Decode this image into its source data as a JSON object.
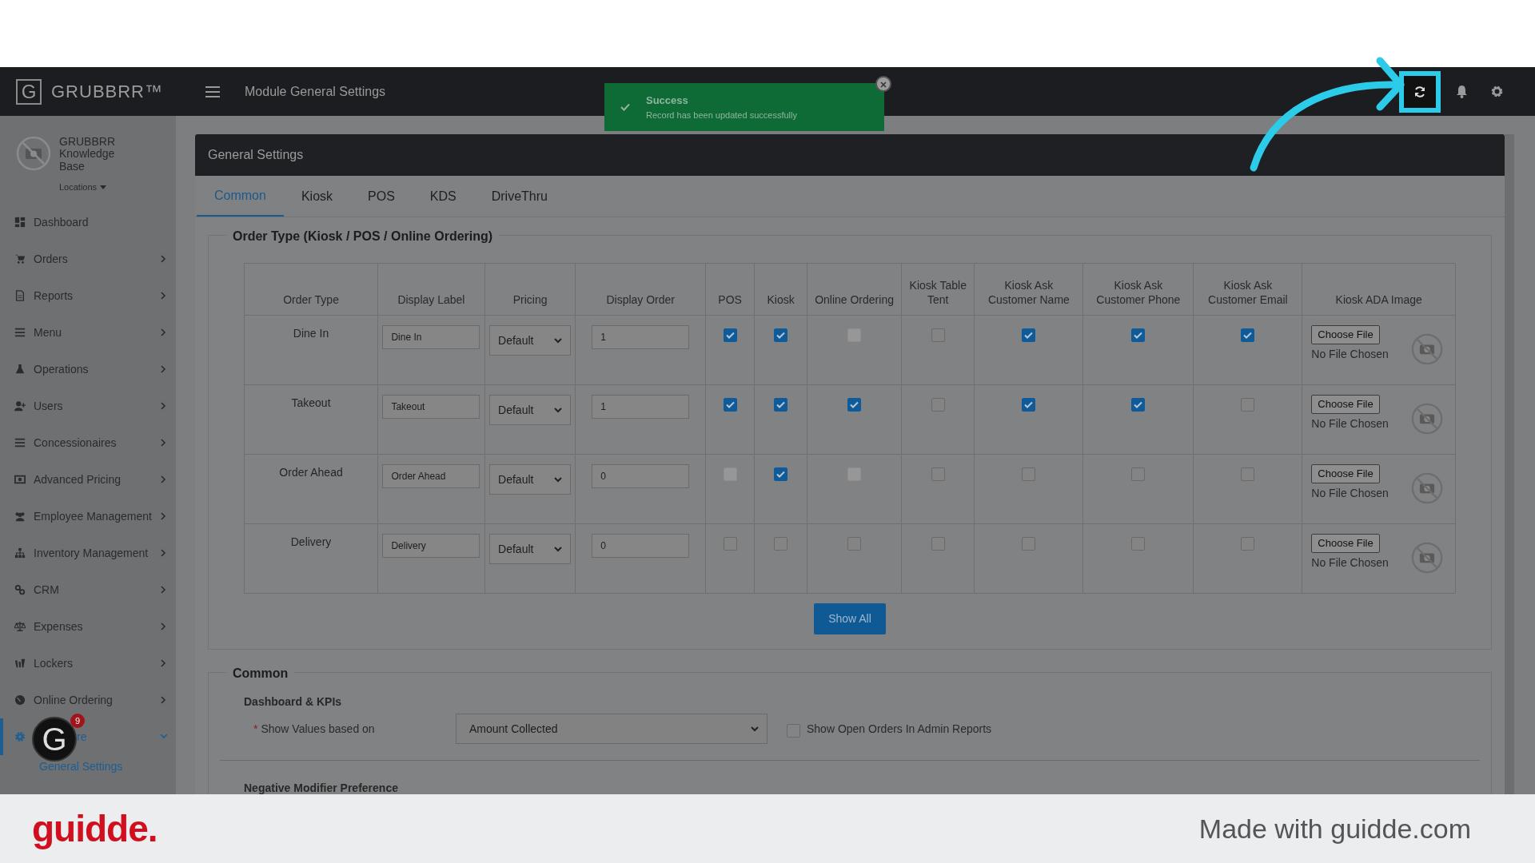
{
  "brand": {
    "logo_letter": "G",
    "name": "GRUBBRR™"
  },
  "account": {
    "name": "GRUBBRR Knowledge Base",
    "locations": "Locations"
  },
  "sidebar": {
    "items": [
      {
        "label": "Dashboard",
        "submenu": false,
        "expanded": false,
        "selected": false
      },
      {
        "label": "Orders",
        "submenu": true,
        "expanded": false,
        "selected": false
      },
      {
        "label": "Reports",
        "submenu": true,
        "expanded": false,
        "selected": false
      },
      {
        "label": "Menu",
        "submenu": true,
        "expanded": false,
        "selected": false
      },
      {
        "label": "Operations",
        "submenu": true,
        "expanded": false,
        "selected": false
      },
      {
        "label": "Users",
        "submenu": true,
        "expanded": false,
        "selected": false
      },
      {
        "label": "Concessionaires",
        "submenu": true,
        "expanded": false,
        "selected": false
      },
      {
        "label": "Advanced Pricing",
        "submenu": true,
        "expanded": false,
        "selected": false
      },
      {
        "label": "Employee Management",
        "submenu": true,
        "expanded": false,
        "selected": false
      },
      {
        "label": "Inventory Management",
        "submenu": true,
        "expanded": false,
        "selected": false
      },
      {
        "label": "CRM",
        "submenu": true,
        "expanded": false,
        "selected": false
      },
      {
        "label": "Expenses",
        "submenu": true,
        "expanded": false,
        "selected": false
      },
      {
        "label": "Lockers",
        "submenu": true,
        "expanded": false,
        "selected": false
      },
      {
        "label": "Online Ordering",
        "submenu": true,
        "expanded": false,
        "selected": false
      },
      {
        "label": "re",
        "submenu": true,
        "expanded": true,
        "selected": true,
        "children": [
          {
            "label": "General Settings",
            "selected": true
          }
        ]
      }
    ]
  },
  "guide_avatar": {
    "letter": "G",
    "badge": "9"
  },
  "topbar": {
    "title": "Module General Settings"
  },
  "toast": {
    "title": "Success",
    "message": "Record has been updated successfully"
  },
  "card": {
    "title": "General Settings"
  },
  "tabs": [
    {
      "label": "Common",
      "selected": true
    },
    {
      "label": "Kiosk",
      "selected": false
    },
    {
      "label": "POS",
      "selected": false
    },
    {
      "label": "KDS",
      "selected": false
    },
    {
      "label": "DriveThru",
      "selected": false
    }
  ],
  "order_types": {
    "legend": "Order Type (Kiosk / POS / Online Ordering)",
    "columns": [
      "Order Type",
      "Display Label",
      "Pricing",
      "Display Order",
      "POS",
      "Kiosk",
      "Online Ordering",
      "Kiosk Table Tent",
      "Kiosk Ask Customer Name",
      "Kiosk Ask Customer Phone",
      "Kiosk Ask Customer Email",
      "Kiosk ADA Image"
    ],
    "rows": [
      {
        "order_type": "Dine In",
        "label": "Dine In",
        "pricing": "Default",
        "display_order": "1",
        "file_button": "Choose File",
        "file_status": "No File Chosen",
        "flags": [
          {
            "checked": true,
            "disabled": false
          },
          {
            "checked": true,
            "disabled": false
          },
          {
            "checked": false,
            "disabled": true
          },
          {
            "checked": false,
            "disabled": false
          },
          {
            "checked": true,
            "disabled": false
          },
          {
            "checked": true,
            "disabled": false
          },
          {
            "checked": true,
            "disabled": false
          }
        ]
      },
      {
        "order_type": "Takeout",
        "label": "Takeout",
        "pricing": "Default",
        "display_order": "1",
        "file_button": "Choose File",
        "file_status": "No File Chosen",
        "flags": [
          {
            "checked": true,
            "disabled": false
          },
          {
            "checked": true,
            "disabled": false
          },
          {
            "checked": true,
            "disabled": false
          },
          {
            "checked": false,
            "disabled": false
          },
          {
            "checked": true,
            "disabled": false
          },
          {
            "checked": true,
            "disabled": false
          },
          {
            "checked": false,
            "disabled": false
          }
        ]
      },
      {
        "order_type": "Order Ahead",
        "label": "Order Ahead",
        "pricing": "Default",
        "display_order": "0",
        "file_button": "Choose File",
        "file_status": "No File Chosen",
        "flags": [
          {
            "checked": false,
            "disabled": true
          },
          {
            "checked": true,
            "disabled": false
          },
          {
            "checked": false,
            "disabled": true
          },
          {
            "checked": false,
            "disabled": false
          },
          {
            "checked": false,
            "disabled": false
          },
          {
            "checked": false,
            "disabled": false
          },
          {
            "checked": false,
            "disabled": false
          }
        ]
      },
      {
        "order_type": "Delivery",
        "label": "Delivery",
        "pricing": "Default",
        "display_order": "0",
        "file_button": "Choose File",
        "file_status": "No File Chosen",
        "flags": [
          {
            "checked": false,
            "disabled": false
          },
          {
            "checked": false,
            "disabled": false
          },
          {
            "checked": false,
            "disabled": false
          },
          {
            "checked": false,
            "disabled": false
          },
          {
            "checked": false,
            "disabled": false
          },
          {
            "checked": false,
            "disabled": false
          },
          {
            "checked": false,
            "disabled": false
          }
        ]
      }
    ],
    "show_all": "Show All"
  },
  "common": {
    "legend": "Common",
    "dashboard_heading": "Dashboard & KPIs",
    "required_mark": "*",
    "show_values_label": "Show Values based on",
    "show_values_value": "Amount Collected",
    "open_orders": {
      "label": "Show Open Orders In Admin Reports",
      "checked": false
    },
    "negative_heading": "Negative Modifier Preference"
  },
  "footer": {
    "brand": "guidde.",
    "credit": "Made with guidde.com"
  }
}
